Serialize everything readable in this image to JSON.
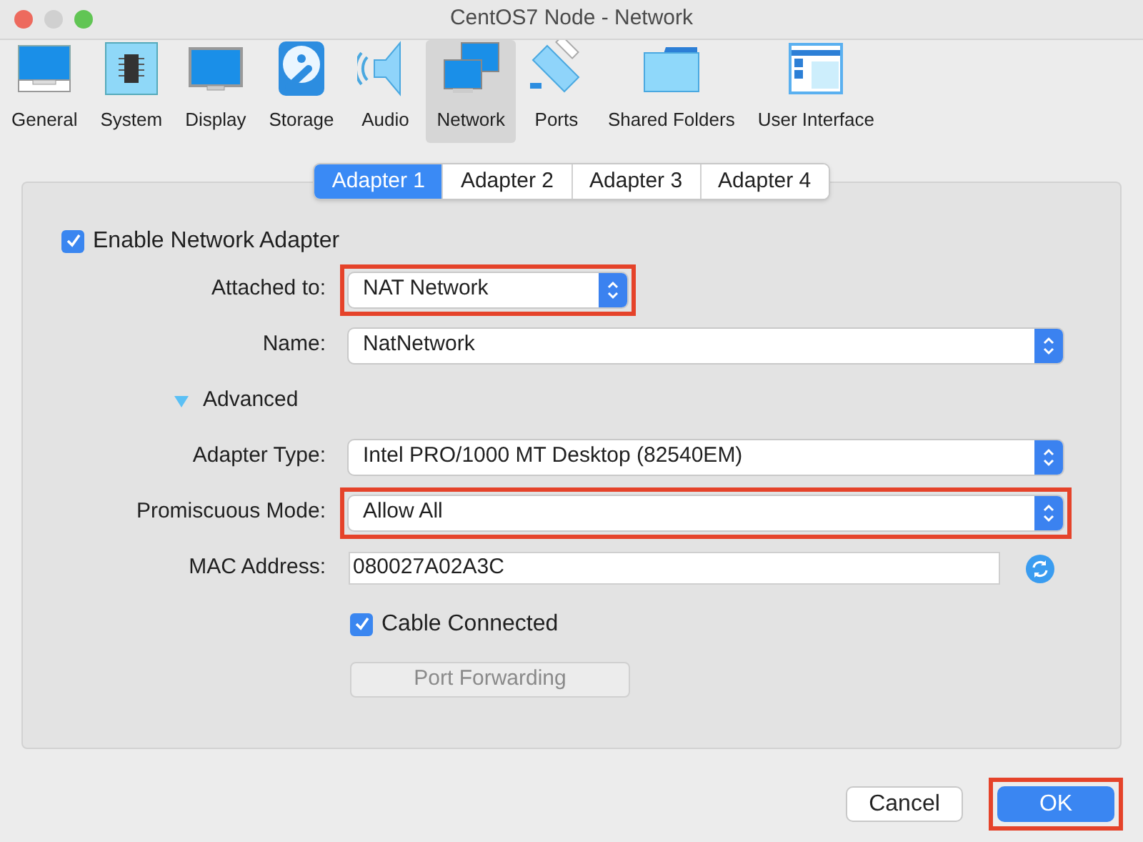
{
  "window": {
    "title": "CentOS7 Node - Network"
  },
  "toolbar": [
    {
      "label": "General",
      "selected": false
    },
    {
      "label": "System",
      "selected": false
    },
    {
      "label": "Display",
      "selected": false
    },
    {
      "label": "Storage",
      "selected": false
    },
    {
      "label": "Audio",
      "selected": false
    },
    {
      "label": "Network",
      "selected": true
    },
    {
      "label": "Ports",
      "selected": false
    },
    {
      "label": "Shared Folders",
      "selected": false
    },
    {
      "label": "User Interface",
      "selected": false
    }
  ],
  "tabs": [
    {
      "label": "Adapter 1",
      "selected": true
    },
    {
      "label": "Adapter 2",
      "selected": false
    },
    {
      "label": "Adapter 3",
      "selected": false
    },
    {
      "label": "Adapter 4",
      "selected": false
    }
  ],
  "form": [
    {
      "kind": "checkbox",
      "label": "Enable Network Adapter",
      "checked": true,
      "indent": false
    },
    {
      "kind": "select",
      "label": "Attached to:",
      "value": "NAT Network",
      "compact": true,
      "highlighted": true
    },
    {
      "kind": "select",
      "label": "Name:",
      "value": "NatNetwork",
      "compact": false,
      "highlighted": false
    },
    {
      "kind": "disclosure",
      "label": "Advanced",
      "expanded": true
    },
    {
      "kind": "select",
      "label": "Adapter Type:",
      "value": "Intel PRO/1000 MT Desktop (82540EM)",
      "compact": false,
      "highlighted": false
    },
    {
      "kind": "select",
      "label": "Promiscuous Mode:",
      "value": "Allow All",
      "compact": false,
      "highlighted": true
    },
    {
      "kind": "text",
      "label": "MAC Address:",
      "value": "080027A02A3C"
    },
    {
      "kind": "checkbox",
      "label": "Cable Connected",
      "checked": true,
      "indent": true
    },
    {
      "kind": "button",
      "label": "Port Forwarding",
      "disabled": true
    }
  ],
  "buttons": [
    {
      "label": "Cancel",
      "default": false,
      "highlighted": false
    },
    {
      "label": "OK",
      "default": true,
      "highlighted": true
    }
  ]
}
